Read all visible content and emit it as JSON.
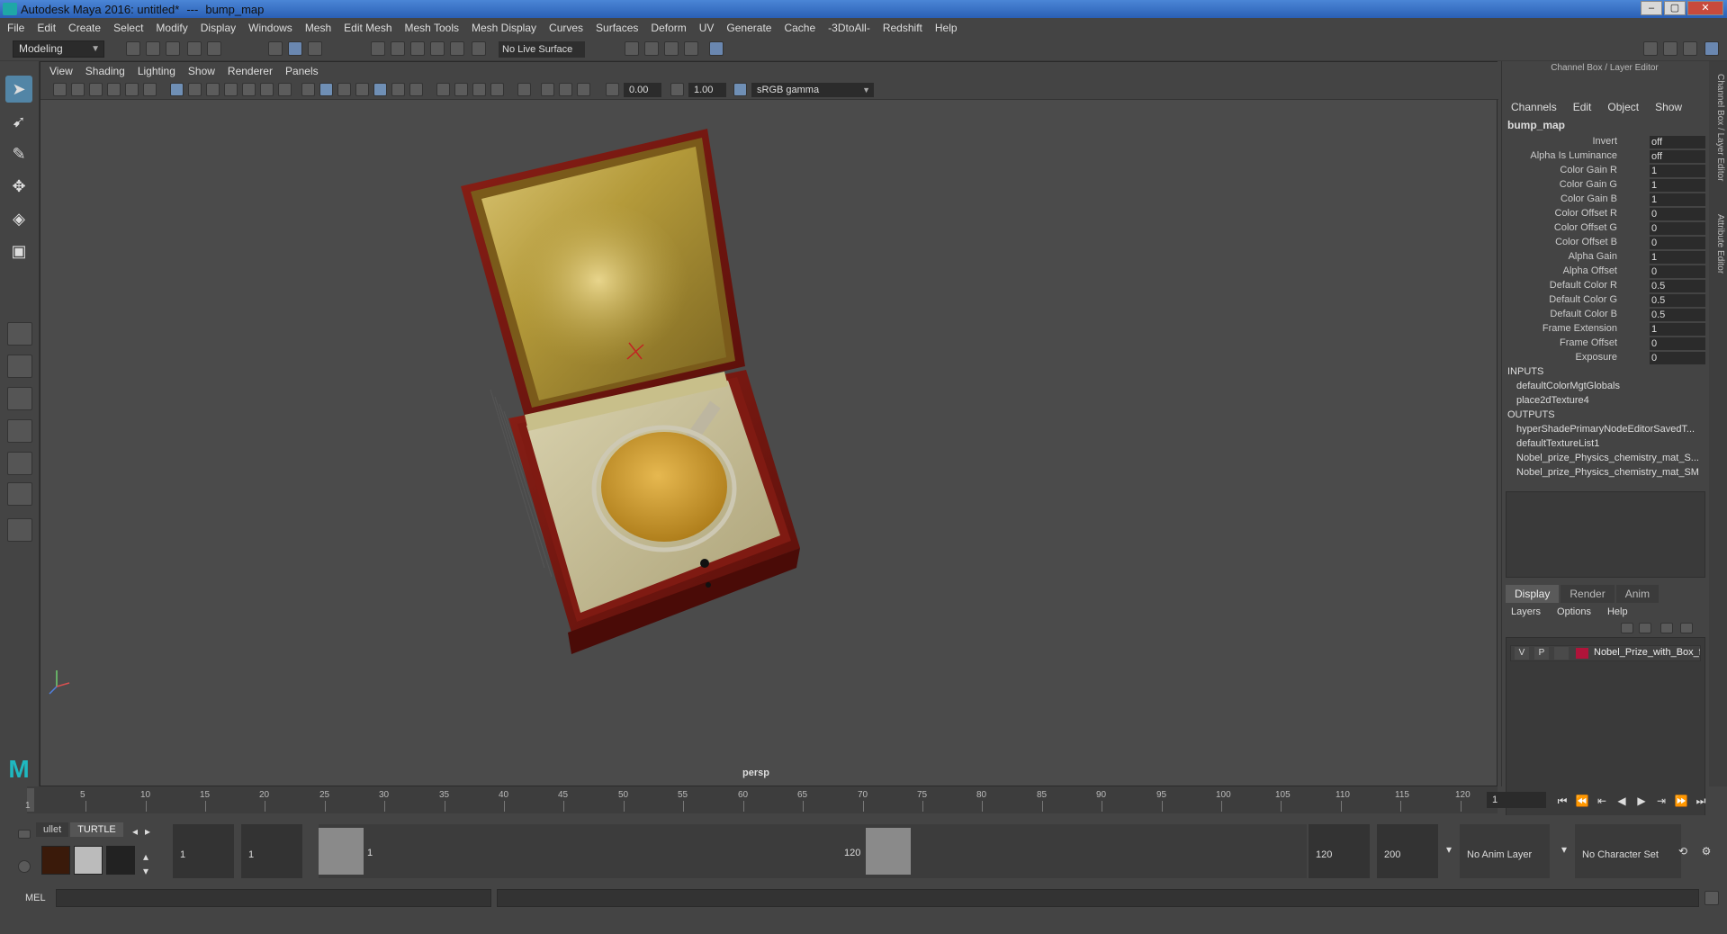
{
  "window": {
    "title": "Autodesk Maya 2016: untitled*",
    "separator": "---",
    "file": "bump_map"
  },
  "menubar": [
    "File",
    "Edit",
    "Create",
    "Select",
    "Modify",
    "Display",
    "Windows",
    "Mesh",
    "Edit Mesh",
    "Mesh Tools",
    "Mesh Display",
    "Curves",
    "Surfaces",
    "Deform",
    "UV",
    "Generate",
    "Cache",
    "-3DtoAll-",
    "Redshift",
    "Help"
  ],
  "toolbar": {
    "mode": "Modeling",
    "live_surface": "No Live Surface"
  },
  "viewport": {
    "menu": [
      "View",
      "Shading",
      "Lighting",
      "Show",
      "Renderer",
      "Panels"
    ],
    "exposure": "0.00",
    "gamma": "1.00",
    "color_space": "sRGB gamma",
    "camera": "persp"
  },
  "channel_box": {
    "header": "Channel Box / Layer Editor",
    "menu": [
      "Channels",
      "Edit",
      "Object",
      "Show"
    ],
    "node": "bump_map",
    "attributes": [
      {
        "label": "Invert",
        "value": "off"
      },
      {
        "label": "Alpha Is Luminance",
        "value": "off"
      },
      {
        "label": "Color Gain R",
        "value": "1"
      },
      {
        "label": "Color Gain G",
        "value": "1"
      },
      {
        "label": "Color Gain B",
        "value": "1"
      },
      {
        "label": "Color Offset R",
        "value": "0"
      },
      {
        "label": "Color Offset G",
        "value": "0"
      },
      {
        "label": "Color Offset B",
        "value": "0"
      },
      {
        "label": "Alpha Gain",
        "value": "1"
      },
      {
        "label": "Alpha Offset",
        "value": "0"
      },
      {
        "label": "Default Color R",
        "value": "0.5"
      },
      {
        "label": "Default Color G",
        "value": "0.5"
      },
      {
        "label": "Default Color B",
        "value": "0.5"
      },
      {
        "label": "Frame Extension",
        "value": "1"
      },
      {
        "label": "Frame Offset",
        "value": "0"
      },
      {
        "label": "Exposure",
        "value": "0"
      }
    ],
    "inputs_title": "INPUTS",
    "inputs": [
      "defaultColorMgtGlobals",
      "place2dTexture4"
    ],
    "outputs_title": "OUTPUTS",
    "outputs": [
      "hyperShadePrimaryNodeEditorSavedT...",
      "defaultTextureList1",
      "Nobel_prize_Physics_chemistry_mat_S...",
      "Nobel_prize_Physics_chemistry_mat_SM"
    ]
  },
  "layer_editor": {
    "tabs": [
      "Display",
      "Render",
      "Anim"
    ],
    "menu": [
      "Layers",
      "Options",
      "Help"
    ],
    "layer": {
      "v": "V",
      "p": "P",
      "name": "Nobel_Prize_with_Box_fo",
      "color": "#b0143a"
    }
  },
  "side_tabs": [
    "Channel Box / Layer Editor",
    "Attribute Editor"
  ],
  "timeline": {
    "ticks": [
      "5",
      "10",
      "15",
      "20",
      "25",
      "30",
      "35",
      "40",
      "45",
      "50",
      "55",
      "60",
      "65",
      "70",
      "75",
      "80",
      "85",
      "90",
      "95",
      "100",
      "105",
      "110",
      "115",
      "120"
    ],
    "start_label": "1",
    "current_frame": "1"
  },
  "range": {
    "shelf_tabs": [
      "ullet",
      "TURTLE"
    ],
    "start": "1",
    "playback_start": "1",
    "range_start_label": "1",
    "range_end_label": "120",
    "playback_end": "120",
    "end": "200",
    "anim_layer": "No Anim Layer",
    "character_set": "No Character Set"
  },
  "command": {
    "label": "MEL"
  }
}
